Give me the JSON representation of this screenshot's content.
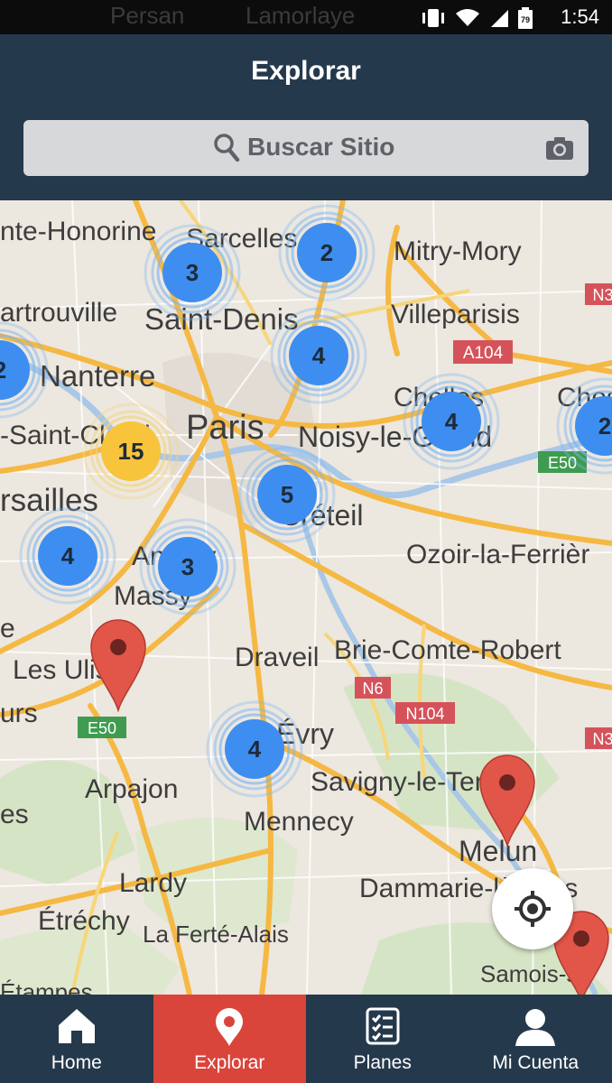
{
  "status_bar": {
    "time": "1:54",
    "battery": "79"
  },
  "header": {
    "title": "Explorar"
  },
  "search": {
    "placeholder": "Buscar Sitio"
  },
  "map": {
    "places": {
      "persan": "Persan",
      "lamorlaye": "Lamorlaye",
      "honorine": "nte-Honorine",
      "sarcelles": "Sarcelles",
      "mitry": "Mitry-Mory",
      "sartrouville": "artrouville",
      "saint_denis": "Saint-Denis",
      "villeparisis": "Villeparisis",
      "nanterre": "Nanterre",
      "chelles": "Chelles",
      "chessy": "Ches",
      "saint_cloud": "-Saint-Cloud",
      "paris": "Paris",
      "noisy": "Noisy-le-Grand",
      "versailles": "rsailles",
      "creteil": "Créteil",
      "ozoir": "Ozoir-la-Ferrièr",
      "antony": "Antony",
      "massy": "Massy",
      "draveil": "Draveil",
      "brie": "Brie-Comte-Robert",
      "les_ulis": "Les Ulis",
      "evry": "Évry",
      "arpajon": "Arpajon",
      "savigny": "Savigny-le-Temple",
      "mennecy": "Mennecy",
      "melun": "Melun",
      "lardy": "Lardy",
      "dammarie": "Dammarie-lès-Lys",
      "etrechy": "Étréchy",
      "ferte_alais": "La Ferté-Alais",
      "samois": "Samois-su",
      "etampes": "Étampes",
      "urs": "urs",
      "es": "es",
      "e": "e"
    },
    "road_signs": {
      "a104": "A104",
      "n6": "N6",
      "n104": "N104",
      "e50_west": "E50",
      "e50_east": "E50",
      "n3_top": "N3",
      "n3_bottom": "N3"
    },
    "clusters": [
      {
        "count": "3",
        "color": "#3d8ef0"
      },
      {
        "count": "2",
        "color": "#3d8ef0"
      },
      {
        "count": "4",
        "color": "#3d8ef0"
      },
      {
        "count": "2",
        "color": "#3d8ef0"
      },
      {
        "count": "15",
        "color": "#f7c43c"
      },
      {
        "count": "4",
        "color": "#3d8ef0"
      },
      {
        "count": "2",
        "color": "#3d8ef0"
      },
      {
        "count": "5",
        "color": "#3d8ef0"
      },
      {
        "count": "4",
        "color": "#3d8ef0"
      },
      {
        "count": "3",
        "color": "#3d8ef0"
      },
      {
        "count": "4",
        "color": "#3d8ef0"
      }
    ],
    "pin_color": "#e2564a"
  },
  "tabs": [
    {
      "label": "Home",
      "icon": "home-icon"
    },
    {
      "label": "Explorar",
      "icon": "location-pin-icon",
      "active": true
    },
    {
      "label": "Planes",
      "icon": "checklist-icon"
    },
    {
      "label": "Mi Cuenta",
      "icon": "user-icon"
    }
  ]
}
